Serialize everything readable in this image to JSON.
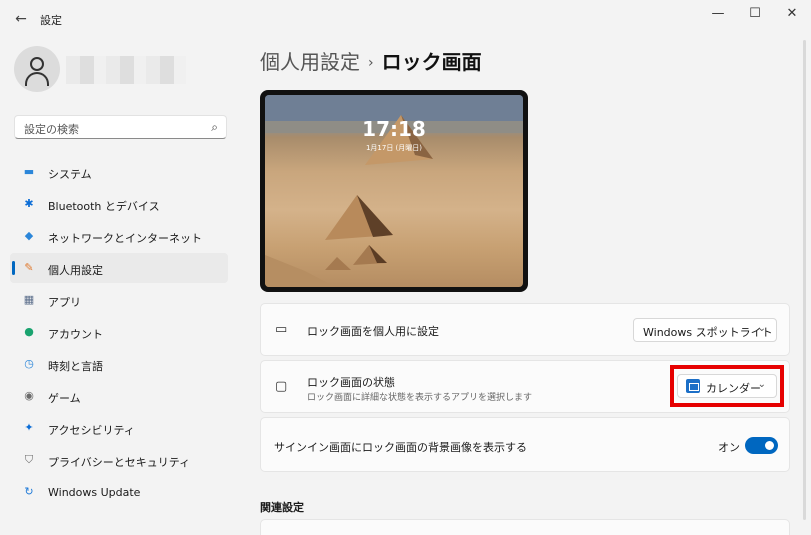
{
  "window": {
    "title": "設定",
    "minimize": "—",
    "maximize": "☐",
    "close": "✕"
  },
  "search": {
    "placeholder": "設定の検索"
  },
  "sidebar": {
    "items": [
      {
        "label": "システム",
        "icon": "monitor-icon",
        "color": "#2b86d9"
      },
      {
        "label": "Bluetooth とデバイス",
        "icon": "bluetooth-icon",
        "color": "#0a6cd6"
      },
      {
        "label": "ネットワークとインターネット",
        "icon": "wifi-icon",
        "color": "#2b86d9"
      },
      {
        "label": "個人用設定",
        "icon": "brush-icon",
        "color": "#e0792e",
        "active": true
      },
      {
        "label": "アプリ",
        "icon": "apps-icon",
        "color": "#5a6d8a"
      },
      {
        "label": "アカウント",
        "icon": "person-icon",
        "color": "#1aa36f"
      },
      {
        "label": "時刻と言語",
        "icon": "globe-clock-icon",
        "color": "#2b86d9"
      },
      {
        "label": "ゲーム",
        "icon": "gamepad-icon",
        "color": "#6b6b6b"
      },
      {
        "label": "アクセシビリティ",
        "icon": "accessibility-icon",
        "color": "#0a6cd6"
      },
      {
        "label": "プライバシーとセキュリティ",
        "icon": "shield-icon",
        "color": "#6b6b6b"
      },
      {
        "label": "Windows Update",
        "icon": "update-icon",
        "color": "#1f7ad8"
      }
    ]
  },
  "breadcrumb": {
    "parent": "個人用設定",
    "separator": "›",
    "current": "ロック画面"
  },
  "preview": {
    "time": "17:18",
    "date": "1月17日 (月曜日)"
  },
  "settings": {
    "personalize": {
      "label": "ロック画面を個人用に設定",
      "value": "Windows スポットライト"
    },
    "status": {
      "label": "ロック画面の状態",
      "description": "ロック画面に詳細な状態を表示するアプリを選択します",
      "value": "カレンダー"
    },
    "signin_bg": {
      "label": "サインイン画面にロック画面の背景画像を表示する",
      "toggle_text": "オン",
      "toggle_on": true
    }
  },
  "related": {
    "title": "関連設定"
  },
  "colors": {
    "accent": "#0067c0",
    "highlight": "#e60000"
  }
}
